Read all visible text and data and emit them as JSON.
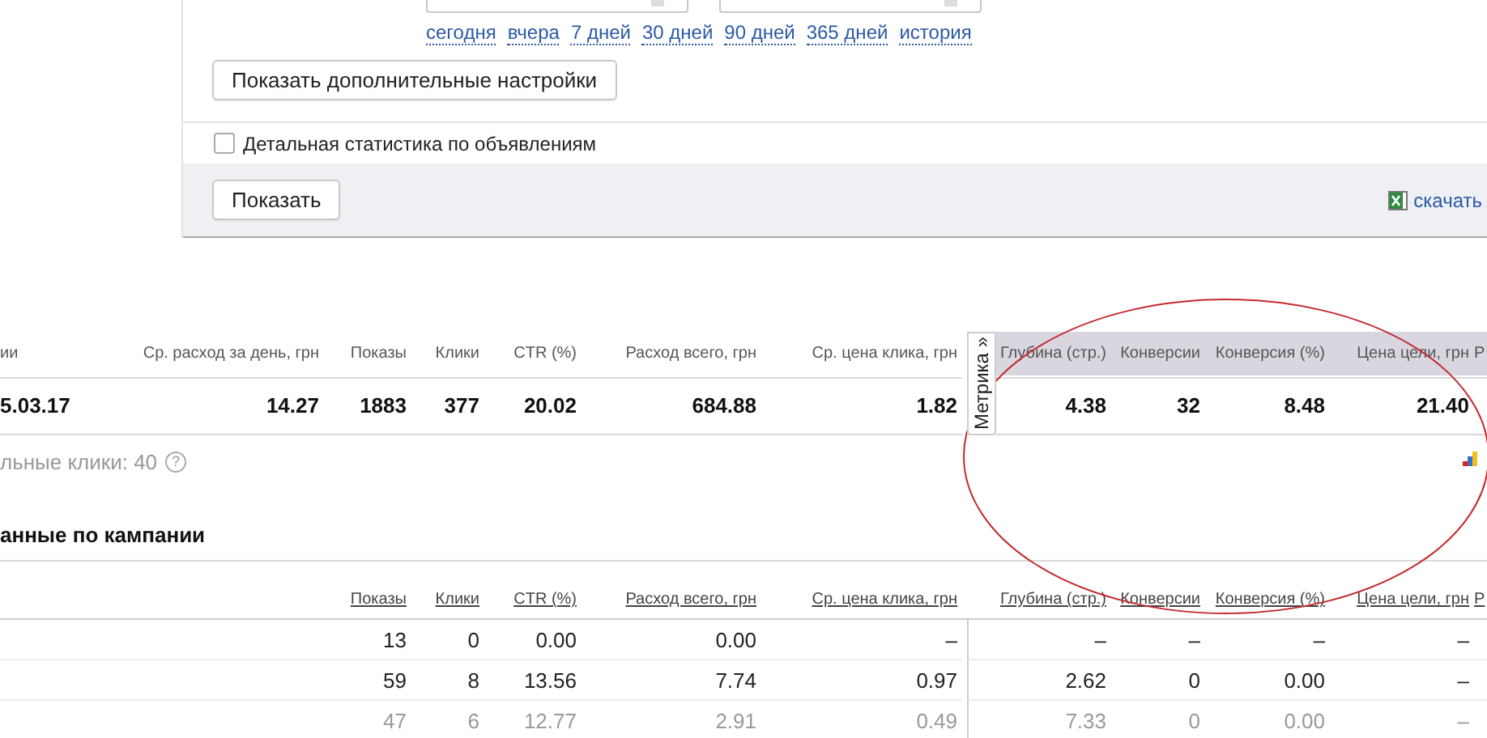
{
  "date_links": [
    {
      "label": "сегодня"
    },
    {
      "label": "вчера"
    },
    {
      "label": "7 дней"
    },
    {
      "label": "30 дней"
    },
    {
      "label": "90 дней"
    },
    {
      "label": "365 дней"
    },
    {
      "label": "история"
    }
  ],
  "more_settings_button": "Показать дополнительные настройки",
  "detail_checkbox": {
    "label": "Детальная статистика по объявлениям",
    "checked": false
  },
  "show_button": "Показать",
  "download_link": "скачать",
  "summary": {
    "columns": [
      {
        "label": "ии",
        "highlighted": false
      },
      {
        "label": "Ср. расход за день, грн",
        "highlighted": false
      },
      {
        "label": "Показы",
        "highlighted": false
      },
      {
        "label": "Клики",
        "highlighted": false
      },
      {
        "label": "CTR (%)",
        "highlighted": false
      },
      {
        "label": "Расход всего, грн",
        "highlighted": false
      },
      {
        "label": "Ср. цена клика, грн",
        "highlighted": false
      },
      {
        "label": "Глубина (стр.)",
        "highlighted": true
      },
      {
        "label": "Конверсии",
        "highlighted": true
      },
      {
        "label": "Конверсия (%)",
        "highlighted": true
      },
      {
        "label": "Цена цели, грн",
        "highlighted": true
      },
      {
        "label": "Р",
        "highlighted": true
      }
    ],
    "metrika_tab": "Метрика »",
    "row": [
      "5.03.17",
      "14.27",
      "1883",
      "377",
      "20.02",
      "684.88",
      "1.82",
      "4.38",
      "32",
      "8.48",
      "21.40"
    ]
  },
  "unique_clicks": "льные клики: 40",
  "help": "?",
  "annotation": {
    "kind": "ellipse"
  },
  "campaign": {
    "title": "анные по кампании",
    "columns": [
      "Показы",
      "Клики",
      "CTR (%)",
      "Расход всего, грн",
      "Ср. цена клика, грн",
      "Глубина (стр.)",
      "Конверсии",
      "Конверсия (%)",
      "Цена цели, грн",
      "Р"
    ],
    "rows": [
      {
        "muted": false,
        "cells": [
          "13",
          "0",
          "0.00",
          "0.00",
          "–",
          "–",
          "–",
          "–",
          "–"
        ]
      },
      {
        "muted": false,
        "cells": [
          "59",
          "8",
          "13.56",
          "7.74",
          "0.97",
          "2.62",
          "0",
          "0.00",
          "–"
        ]
      },
      {
        "muted": true,
        "cells": [
          "47",
          "6",
          "12.77",
          "2.91",
          "0.49",
          "7.33",
          "0",
          "0.00",
          "–"
        ]
      }
    ]
  }
}
